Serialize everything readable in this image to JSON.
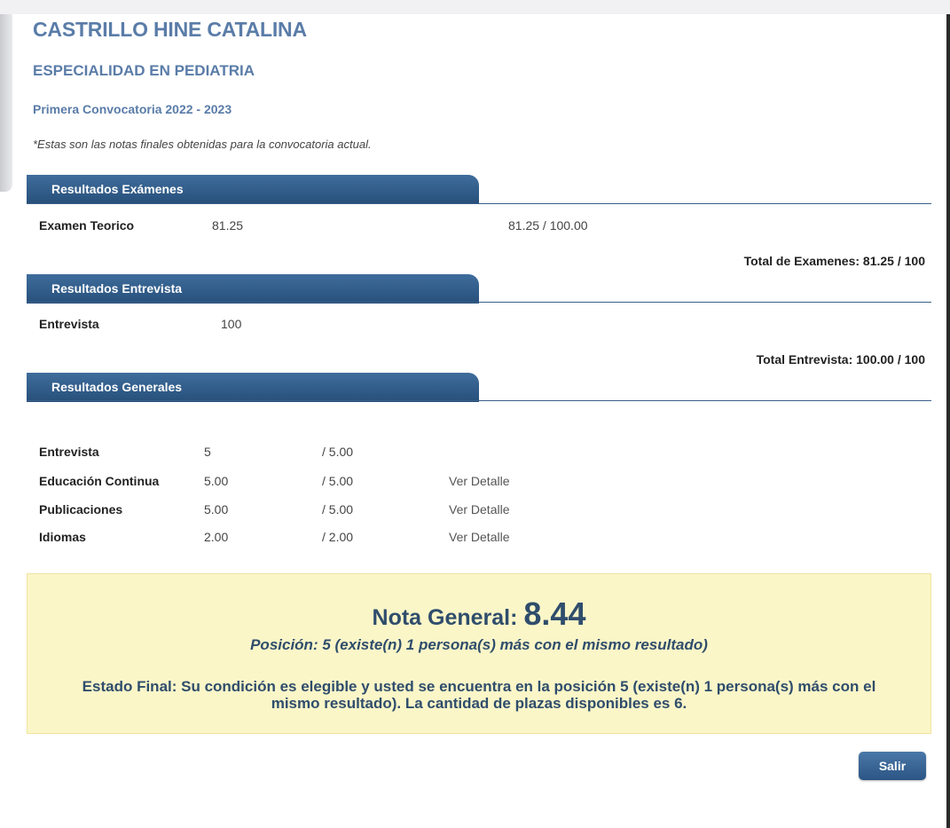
{
  "header": {
    "name": "CASTRILLO HINE CATALINA",
    "specialty": "ESPECIALIDAD EN PEDIATRIA",
    "convocatoria": "Primera Convocatoria 2022 - 2023",
    "note": "*Estas son las notas finales obtenidas para la convocatoria actual."
  },
  "examenes": {
    "title": "Resultados Exámenes",
    "row": {
      "label": "Examen Teorico",
      "value": "81.25",
      "score": "81.25 / 100.00"
    },
    "total": "Total de Examenes: 81.25 / 100"
  },
  "entrevista": {
    "title": "Resultados Entrevista",
    "row": {
      "label": "Entrevista",
      "value": "100"
    },
    "total": "Total Entrevista: 100.00 / 100"
  },
  "generales": {
    "title": "Resultados Generales",
    "rows": [
      {
        "label": "Entrevista",
        "value": "5",
        "max": "/ 5.00",
        "link": ""
      },
      {
        "label": "Educación Continua",
        "value": "5.00",
        "max": "/ 5.00",
        "link": "Ver Detalle"
      },
      {
        "label": "Publicaciones",
        "value": "5.00",
        "max": "/ 5.00",
        "link": "Ver Detalle"
      },
      {
        "label": "Idiomas",
        "value": "2.00",
        "max": "/ 2.00",
        "link": "Ver Detalle"
      }
    ]
  },
  "summary": {
    "nota_label": "Nota General:",
    "nota_value": "8.44",
    "posicion": "Posición: 5 (existe(n) 1 persona(s) más con el mismo resultado)",
    "estado": "Estado Final: Su condición es elegible y usted se encuentra en la posición 5 (existe(n) 1 persona(s) más con el mismo resultado). La cantidad de plazas disponibles es 6."
  },
  "actions": {
    "salir": "Salir"
  },
  "colors": {
    "header_blue": "#5a7ca8",
    "section_bar": "#2f5c8a",
    "summary_bg": "#fbf6c8"
  }
}
